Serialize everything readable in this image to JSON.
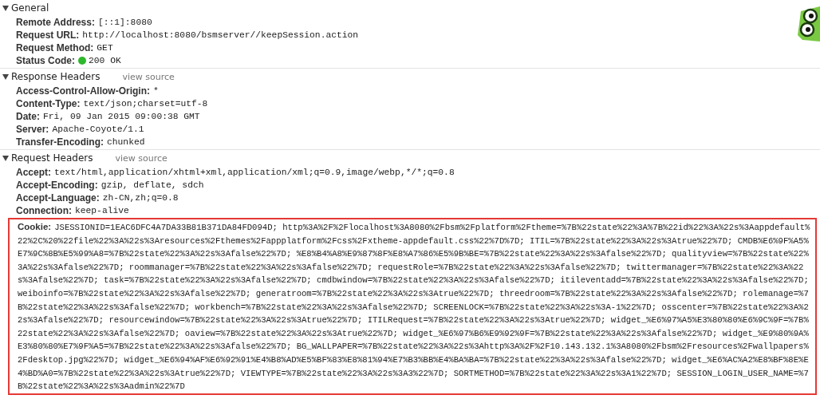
{
  "sections": [
    {
      "title": "General",
      "expanded": true,
      "rows": [
        {
          "name": "Remote Address:",
          "value": "[::1]:8080",
          "highlighted": false
        },
        {
          "name": "Request URL:",
          "value": "http://localhost:8080/bsmserver//keepSession.action",
          "highlighted": false
        },
        {
          "name": "Request Method:",
          "value": "GET",
          "highlighted": false
        },
        {
          "name": "Status Code:",
          "value": "200 OK",
          "color": "#2db82d",
          "highlighted": false
        }
      ]
    },
    {
      "title": "Response Headers",
      "link": "view source",
      "expanded": true,
      "rows": [
        {
          "name": "Access-Control-Allow-Origin:",
          "value": "*",
          "highlighted": false
        },
        {
          "name": "Content-Type:",
          "value": "text/json;charset=utf-8",
          "highlighted": false
        },
        {
          "name": "Date:",
          "value": "Fri, 09 Jan 2015 09:00:38 GMT",
          "highlighted": false
        },
        {
          "name": "Server:",
          "value": "Apache-Coyote/1.1",
          "highlighted": false
        },
        {
          "name": "Transfer-Encoding:",
          "value": "chunked",
          "highlighted": false
        }
      ]
    },
    {
      "title": "Request Headers",
      "link": "view source",
      "expanded": true,
      "rows": [
        {
          "name": "Accept:",
          "value": "text/html,application/xhtml+xml,application/xml;q=0.9,image/webp,*/*;q=0.8",
          "highlighted": false
        },
        {
          "name": "Accept-Encoding:",
          "value": "gzip, deflate, sdch",
          "highlighted": false
        },
        {
          "name": "Accept-Language:",
          "value": "zh-CN,zh;q=0.8",
          "highlighted": false
        },
        {
          "name": "Connection:",
          "value": "keep-alive",
          "highlighted": false
        },
        {
          "name": "Cookie:",
          "value": "JSESSIONID=1EAC6DFC4A7DA33B81B371DA84FD094D; http%3A%2F%2Flocalhost%3A8080%2Fbsm%2Fplatform%2Ftheme=%7B%22state%22%3A%7B%22id%22%3A%22s%3Aappdefault%22%2C%20%22file%22%3A%22s%3Aresources%2Fthemes%2Fappplatform%2Fcss%2Fxtheme-appdefault.css%22%7D%7D; ITIL=%7B%22state%22%3A%22s%3Atrue%22%7D; CMDB%E6%9F%A5%E7%9C%8B%E5%99%A8=%7B%22state%22%3A%22s%3Afalse%22%7D; %E8%B4%A8%E9%87%8F%E8%A7%86%E5%9B%BE=%7B%22state%22%3A%22s%3Afalse%22%7D; qualityview=%7B%22state%22%3A%22s%3Afalse%22%7D; roommanager=%7B%22state%22%3A%22s%3Afalse%22%7D; requestRole=%7B%22state%22%3A%22s%3Afalse%22%7D; twittermanager=%7B%22state%22%3A%22s%3Afalse%22%7D; task=%7B%22state%22%3A%22s%3Afalse%22%7D; cmdbwindow=%7B%22state%22%3A%22s%3Afalse%22%7D; itileventadd=%7B%22state%22%3A%22s%3Afalse%22%7D; weiboinfo=%7B%22state%22%3A%22s%3Afalse%22%7D; generatroom=%7B%22state%22%3A%22s%3Atrue%22%7D; threedroom=%7B%22state%22%3A%22s%3Afalse%22%7D; rolemanage=%7B%22state%22%3A%22s%3Afalse%22%7D; workbench=%7B%22state%22%3A%22s%3Afalse%22%7D; SCREENLOCK=%7B%22state%22%3A%22s%3A-1%22%7D; osscenter=%7B%22state%22%3A%22s%3Afalse%22%7D; resourcewindow=%7B%22state%22%3A%22s%3Atrue%22%7D; ITILRequest=%7B%22state%22%3A%22s%3Atrue%22%7D; widget_%E6%97%A5%E3%80%80%E6%9C%9F=%7B%22state%22%3A%22s%3Afalse%22%7D; oaview=%7B%22state%22%3A%22s%3Atrue%22%7D; widget_%E6%97%B6%E9%92%9F=%7B%22state%22%3A%22s%3Afalse%22%7D; widget_%E9%80%9A%E3%80%80%E7%9F%A5=%7B%22state%22%3A%22s%3Afalse%22%7D; BG_WALLPAPER=%7B%22state%22%3A%22s%3Ahttp%3A%2F%2F10.143.132.1%3A8080%2Fbsm%2Fresources%2Fwallpapers%2Fdesktop.jpg%22%7D; widget_%E6%94%AF%E6%92%91%E4%B8%AD%E5%BF%83%E8%81%94%E7%B3%BB%E4%BA%BA=%7B%22state%22%3A%22s%3Afalse%22%7D; widget_%E6%AC%A2%E8%BF%8E%E4%BD%A0=%7B%22state%22%3A%22s%3Atrue%22%7D; VIEWTYPE=%7B%22state%22%3A%22s%3A3%22%7D; SORTMETHOD=%7B%22state%22%3A%22s%3A1%22%7D; SESSION_LOGIN_USER_NAME=%7B%22state%22%3A%22s%3Aadmin%22%7D",
          "highlighted": true
        }
      ]
    }
  ]
}
